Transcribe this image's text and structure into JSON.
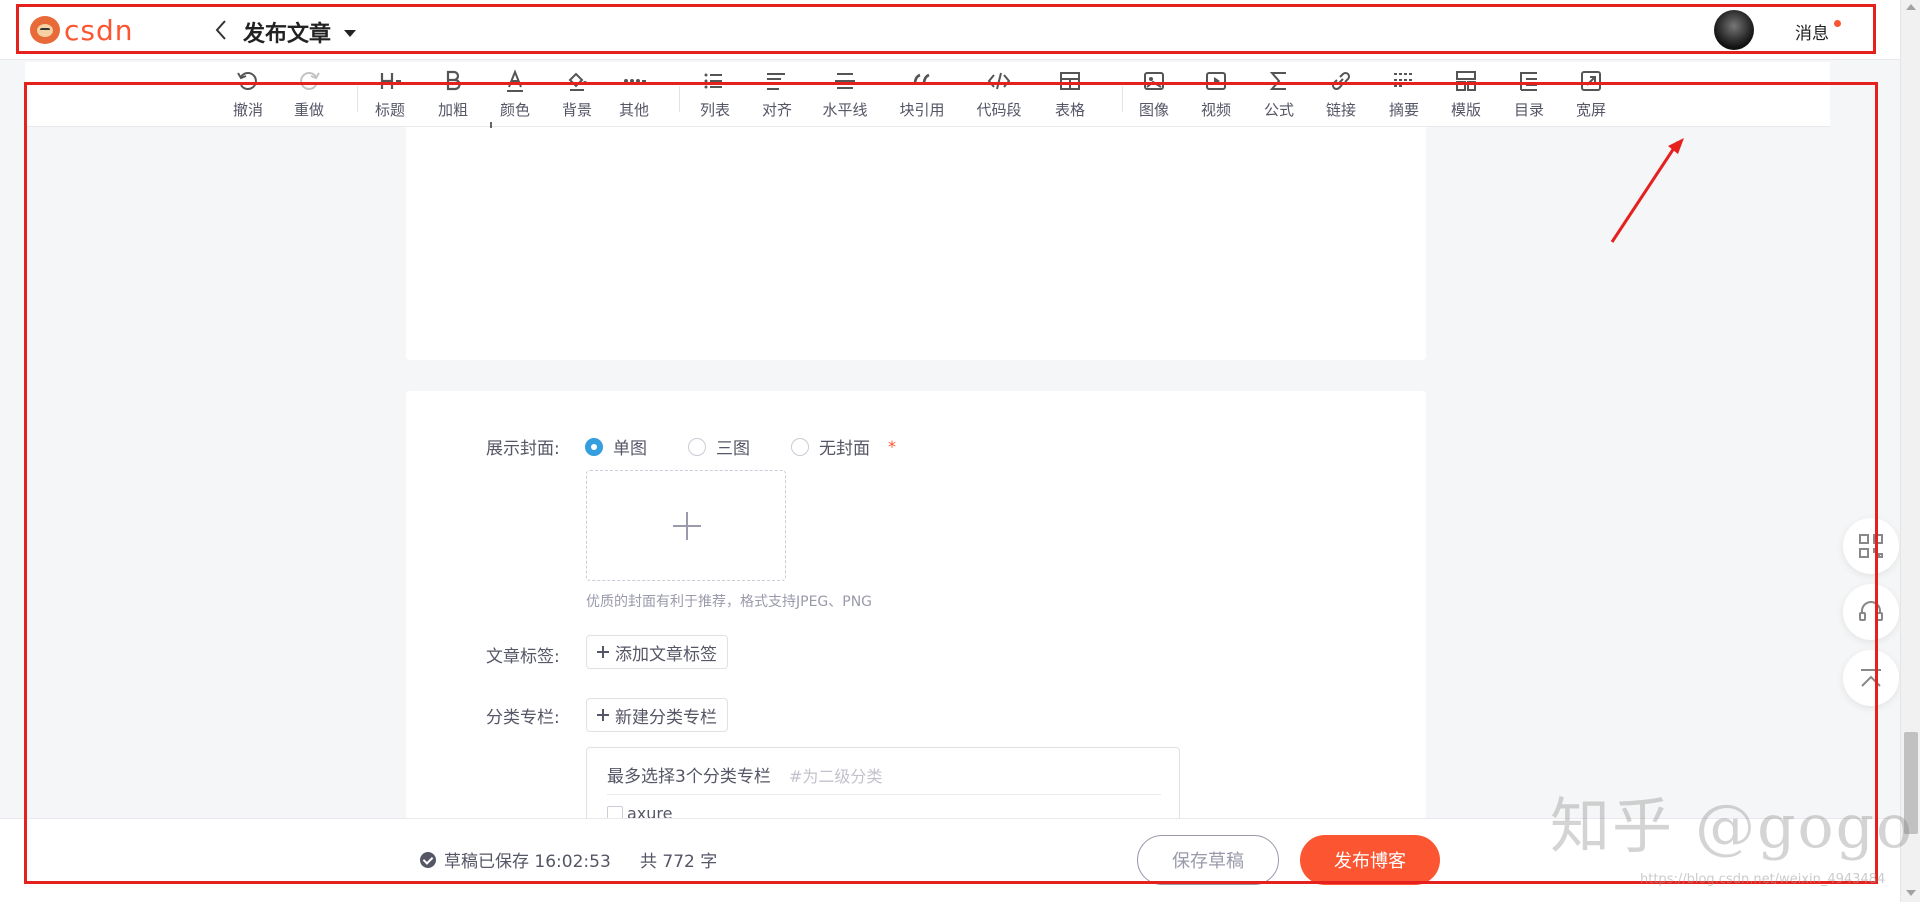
{
  "header": {
    "logo_text": "csdn",
    "title": "发布文章",
    "message_label": "消息"
  },
  "toolbar": {
    "items": [
      {
        "label": "撤消",
        "icon": "undo-icon",
        "enabled": true
      },
      {
        "label": "重做",
        "icon": "redo-icon",
        "enabled": false
      },
      {
        "label": "标题",
        "icon": "heading-icon",
        "enabled": true
      },
      {
        "label": "加粗",
        "icon": "bold-icon",
        "enabled": true
      },
      {
        "label": "颜色",
        "icon": "font-color-icon",
        "enabled": true
      },
      {
        "label": "背景",
        "icon": "background-color-icon",
        "enabled": true
      },
      {
        "label": "其他",
        "icon": "more-icon",
        "enabled": true
      },
      {
        "label": "列表",
        "icon": "list-icon",
        "enabled": true
      },
      {
        "label": "对齐",
        "icon": "align-icon",
        "enabled": true
      },
      {
        "label": "水平线",
        "icon": "horizontal-rule-icon",
        "enabled": true
      },
      {
        "label": "块引用",
        "icon": "blockquote-icon",
        "enabled": true
      },
      {
        "label": "代码段",
        "icon": "code-block-icon",
        "enabled": true
      },
      {
        "label": "表格",
        "icon": "table-icon",
        "enabled": true
      },
      {
        "label": "图像",
        "icon": "image-icon",
        "enabled": true
      },
      {
        "label": "视频",
        "icon": "video-icon",
        "enabled": true
      },
      {
        "label": "公式",
        "icon": "formula-icon",
        "enabled": true
      },
      {
        "label": "链接",
        "icon": "link-icon",
        "enabled": true
      },
      {
        "label": "摘要",
        "icon": "summary-icon",
        "enabled": true
      },
      {
        "label": "模版",
        "icon": "template-icon",
        "enabled": true
      },
      {
        "label": "目录",
        "icon": "toc-icon",
        "enabled": true
      },
      {
        "label": "宽屏",
        "icon": "widescreen-icon",
        "enabled": true
      }
    ]
  },
  "cover": {
    "label": "展示封面:",
    "options": [
      "单图",
      "三图",
      "无封面"
    ],
    "selected": "单图",
    "required_mark": "*",
    "hint": "优质的封面有利于推荐，格式支持JPEG、PNG"
  },
  "tags": {
    "label": "文章标签:",
    "add_button": "添加文章标签"
  },
  "category": {
    "label": "分类专栏:",
    "new_button": "新建分类专栏",
    "box_title": "最多选择3个分类专栏",
    "box_subtitle": "#为二级分类",
    "items": [
      "axure"
    ]
  },
  "footer": {
    "draft_status": "草稿已保存 16:02:53",
    "word_count": "共 772 字",
    "save_draft": "保存草稿",
    "publish": "发布博客"
  },
  "watermark": {
    "text": "知乎 @gogo",
    "url": "https://blog.csdn.net/weixin_4943484"
  },
  "colors": {
    "brand": "#fc5531",
    "radio_selected": "#349edf",
    "annotation": "#e5211d"
  }
}
